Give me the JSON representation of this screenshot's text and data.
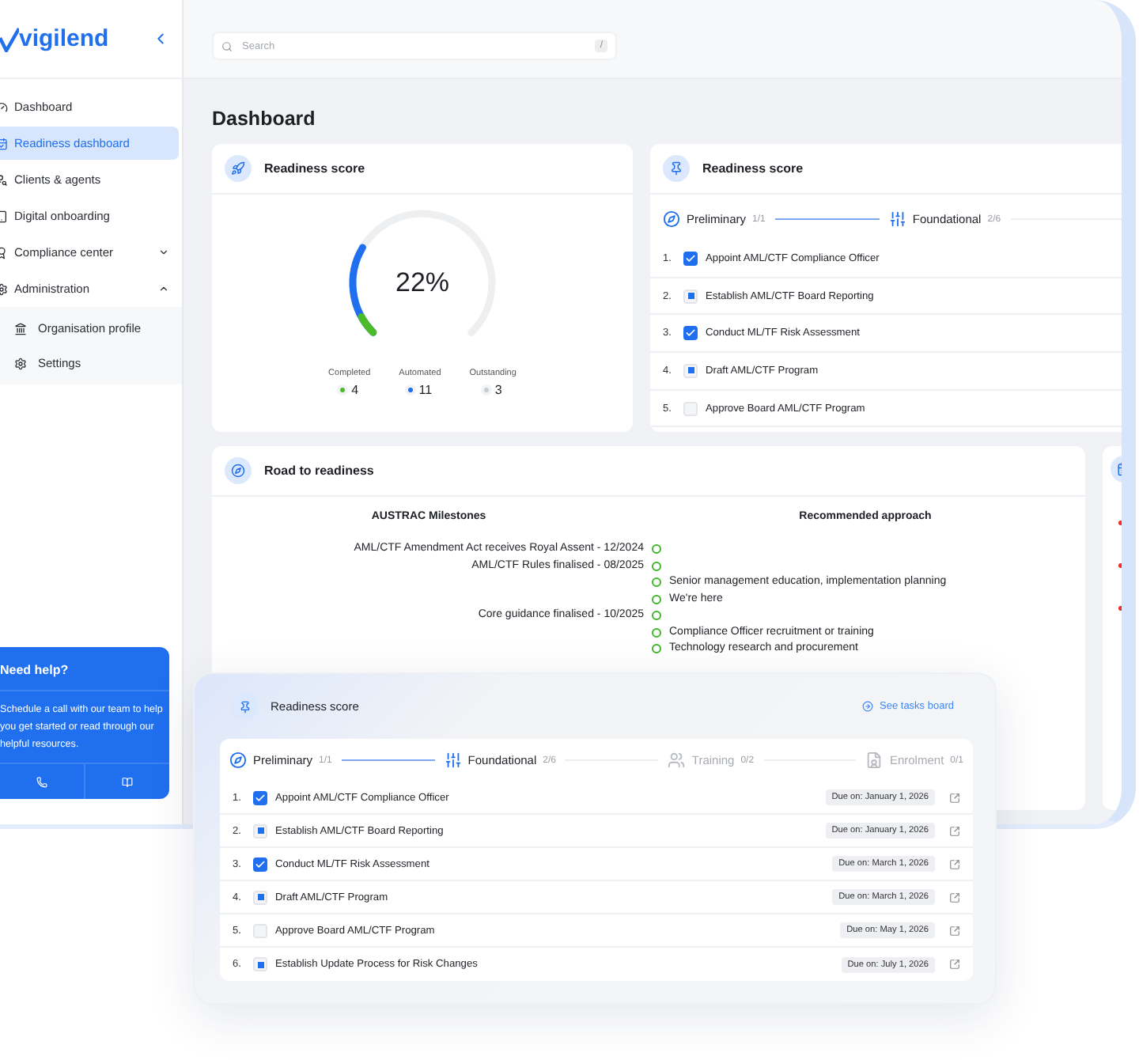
{
  "brand": "vigilend",
  "search": {
    "placeholder": "Search",
    "shortcut": "/"
  },
  "sidebar": {
    "items": [
      {
        "label": "Dashboard",
        "selected": false
      },
      {
        "label": "Readiness dashboard",
        "selected": true
      },
      {
        "label": "Clients & agents",
        "selected": false
      },
      {
        "label": "Digital onboarding",
        "selected": false
      },
      {
        "label": "Compliance center",
        "selected": false,
        "expanded": false
      },
      {
        "label": "Administration",
        "selected": false,
        "expanded": true,
        "children": [
          {
            "label": "Organisation profile",
            "selected": false
          },
          {
            "label": "Settings",
            "selected": false
          }
        ]
      }
    ]
  },
  "help": {
    "title": "Need help?",
    "text": "Schedule a call with our team to help you get started or read through our helpful resources."
  },
  "page_title": "Dashboard",
  "score_card": {
    "title": "Readiness score",
    "value": "22%",
    "segments": [
      {
        "kind": "automated",
        "level": 0.28
      },
      {
        "kind": "completed",
        "level": 0.06
      }
    ],
    "legend": [
      {
        "label": "Completed",
        "value": "4",
        "color": "#4cbb2a"
      },
      {
        "label": "Automated",
        "value": "11",
        "color": "#1f6fef"
      },
      {
        "label": "Outstanding",
        "value": "3",
        "color": "#c9cbd0"
      }
    ]
  },
  "tasks_card": {
    "title": "Readiness score",
    "steps": [
      {
        "label": "Preliminary",
        "count": "1/1",
        "completed": true,
        "disabled": false
      },
      {
        "label": "Foundational",
        "count": "2/6",
        "completed": false,
        "disabled": false
      }
    ],
    "tasks": [
      {
        "number": "1.",
        "label": "Appoint AML/CTF Compliance Officer",
        "kind": "checkbox",
        "checked": true
      },
      {
        "number": "2.",
        "label": "Establish AML/CTF Board Reporting",
        "kind": "in_progress"
      },
      {
        "number": "3.",
        "label": "Conduct ML/TF Risk Assessment",
        "kind": "checkbox",
        "checked": true
      },
      {
        "number": "4.",
        "label": "Draft AML/CTF Program",
        "kind": "in_progress"
      },
      {
        "number": "5.",
        "label": "Approve Board AML/CTF Program",
        "kind": "checkbox",
        "checked": false
      }
    ]
  },
  "road_card": {
    "title": "Road to readiness",
    "col_left": "AUSTRAC Milestones",
    "col_right": "Recommended approach",
    "rows": [
      {
        "milestone": "AML/CTF Amendment Act receives Royal Assent - 12/2024"
      },
      {
        "milestone": "AML/CTF Rules finalised - 08/2025"
      },
      {
        "approach": "Senior management education, implementation planning"
      },
      {
        "approach": "We're here"
      },
      {
        "milestone": "Core guidance finalised - 10/2025"
      },
      {
        "approach": "Compliance Officer recruitment or training"
      },
      {
        "approach": "Technology research and procurement"
      }
    ]
  },
  "overlay_card": {
    "title": "Readiness score",
    "link": "See tasks board",
    "steps": [
      {
        "label": "Preliminary",
        "count": "1/1",
        "completed": true,
        "disabled": false
      },
      {
        "label": "Foundational",
        "count": "2/6",
        "completed": false,
        "disabled": false
      },
      {
        "label": "Training",
        "count": "0/2",
        "completed": false,
        "disabled": true
      },
      {
        "label": "Enrolment",
        "count": "0/1",
        "disabled": true
      }
    ],
    "tasks": [
      {
        "number": "1.",
        "label": "Appoint AML/CTF Compliance Officer",
        "kind": "checkbox",
        "checked": true,
        "due": "Due on: January 1, 2026"
      },
      {
        "number": "2.",
        "label": "Establish AML/CTF Board Reporting",
        "kind": "in_progress",
        "due": "Due on: January 1, 2026"
      },
      {
        "number": "3.",
        "label": "Conduct ML/TF Risk Assessment",
        "kind": "checkbox",
        "checked": true,
        "due": "Due on: March 1, 2026"
      },
      {
        "number": "4.",
        "label": "Draft AML/CTF Program",
        "kind": "in_progress",
        "due": "Due on: March 1, 2026"
      },
      {
        "number": "5.",
        "label": "Approve Board AML/CTF Program",
        "kind": "checkbox",
        "checked": false,
        "due": "Due on: May 1, 2026"
      },
      {
        "number": "6.",
        "label": "Establish Update Process for Risk Changes",
        "kind": "in_progress",
        "due": "Due on: July 1, 2026"
      }
    ]
  }
}
